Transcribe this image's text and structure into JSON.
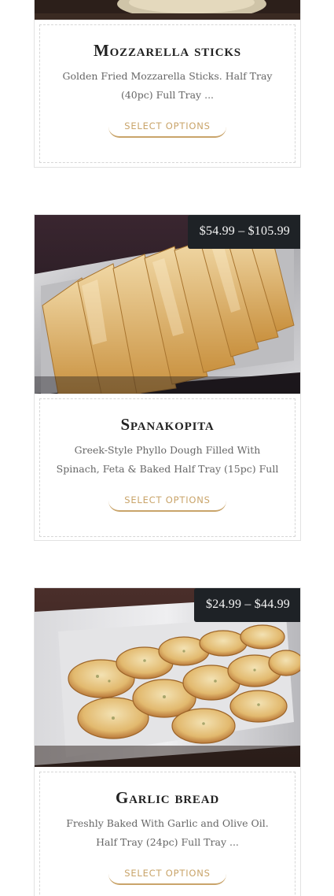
{
  "products": [
    {
      "title": "Mozzarella sticks",
      "description": "Golden Fried Mozzarella Sticks. Half Tray (40pc) Full Tray ...",
      "button_label": "SELECT OPTIONS"
    },
    {
      "title": "Spanakopita",
      "price": "$54.99 – $105.99",
      "description": "Greek-Style Phyllo Dough Filled With Spinach, Feta & Baked Half Tray (15pc) Full",
      "button_label": "SELECT OPTIONS"
    },
    {
      "title": "Garlic bread",
      "price": "$24.99 – $44.99",
      "description": "Freshly Baked With Garlic and Olive Oil. Half Tray (24pc) Full Tray ...",
      "button_label": "SELECT OPTIONS"
    }
  ],
  "colors": {
    "accent": "#c9a46a",
    "badge_bg": "#1e2226",
    "title": "#222222",
    "text": "#666666"
  }
}
